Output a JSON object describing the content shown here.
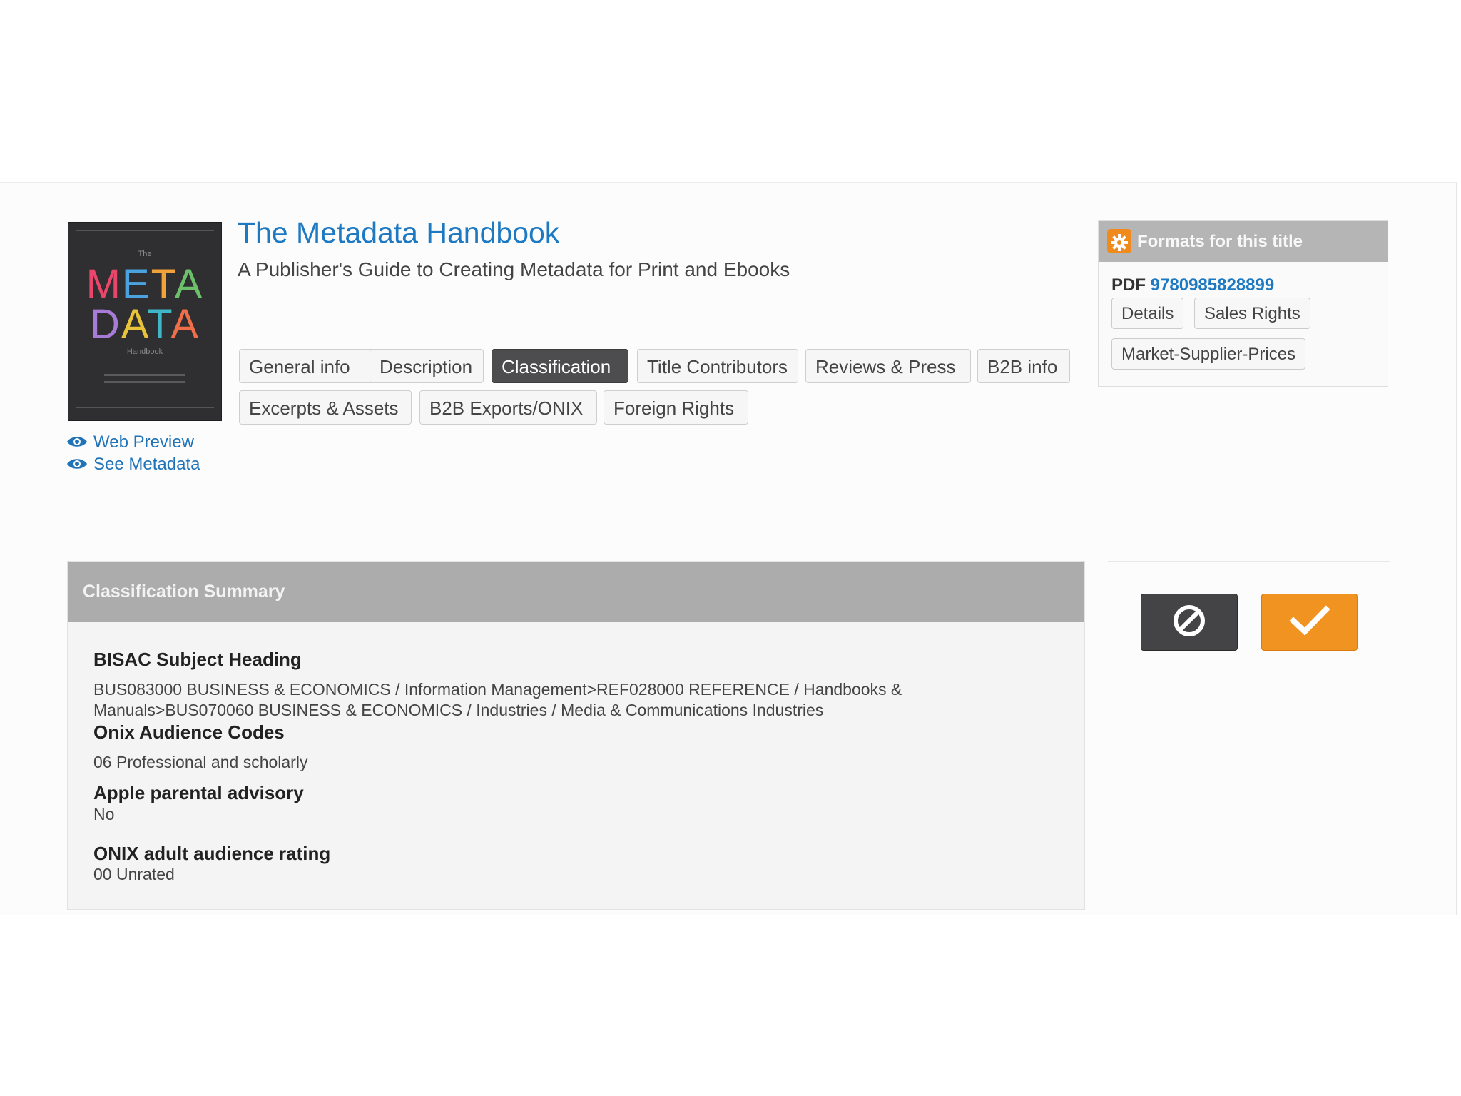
{
  "book": {
    "title": "The Metadata Handbook",
    "subtitle": "A Publisher's Guide to Creating Metadata for Print and Ebooks"
  },
  "cover": {
    "the": "The",
    "line1": "META",
    "line2": "DATA",
    "small": "Handbook"
  },
  "sidebar": {
    "web_preview": "Web Preview",
    "see_metadata": "See Metadata"
  },
  "tabs": [
    {
      "label": "General info"
    },
    {
      "label": "Description"
    },
    {
      "label": "Classification",
      "active": true
    },
    {
      "label": "Title Contributors"
    },
    {
      "label": "Reviews & Press"
    },
    {
      "label": "B2B info"
    },
    {
      "label": "Excerpts & Assets"
    },
    {
      "label": "B2B Exports/ONIX"
    },
    {
      "label": "Foreign Rights"
    }
  ],
  "formats": {
    "header": "Formats for this title",
    "format": "PDF",
    "isbn": "9780985828899",
    "buttons": [
      "Details",
      "Sales Rights",
      "Market-Supplier-Prices"
    ]
  },
  "summary": {
    "header": "Classification Summary",
    "fields": [
      {
        "label": "BISAC Subject Heading",
        "value_line1": "BUS083000 BUSINESS & ECONOMICS / Information Management>REF028000 REFERENCE / Handbooks &",
        "value_line2": "Manuals>BUS070060 BUSINESS & ECONOMICS / Industries / Media & Communications Industries"
      },
      {
        "label": "Onix Audience Codes",
        "value": "06 Professional and scholarly"
      },
      {
        "label": "Apple parental advisory",
        "value": "No"
      },
      {
        "label": "ONIX adult audience rating",
        "value": "00 Unrated"
      }
    ]
  },
  "actions": {
    "cancel_icon": "ban-icon",
    "confirm_icon": "checkmark-icon"
  },
  "colors": {
    "link": "#1d79c2",
    "accent_orange": "#f19320",
    "active_tab": "#4d4d4f"
  }
}
